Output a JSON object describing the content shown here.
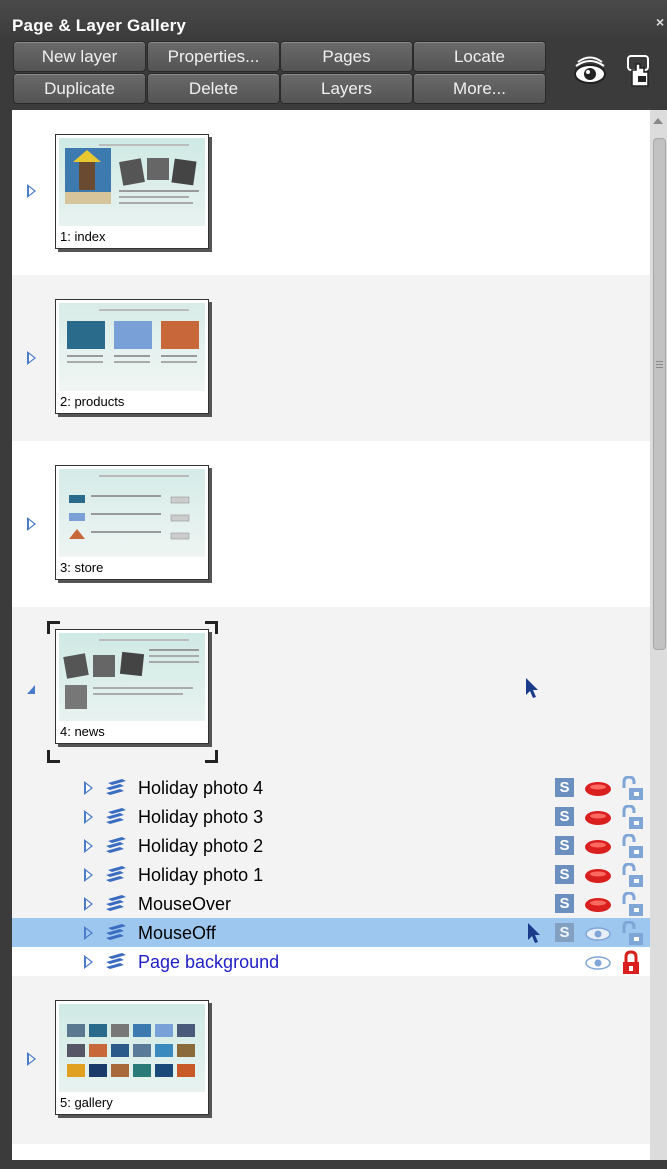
{
  "title": "Page & Layer Gallery",
  "toolbar": {
    "row1": [
      "New layer",
      "Properties...",
      "Pages",
      "Locate"
    ],
    "row2": [
      "Duplicate",
      "Delete",
      "Layers",
      "More..."
    ],
    "icons": [
      "visibility-eye-icon",
      "lock-hand-icon"
    ]
  },
  "pages": [
    {
      "label": "1: index",
      "expanded": false
    },
    {
      "label": "2: products",
      "expanded": false
    },
    {
      "label": "3: store",
      "expanded": false
    },
    {
      "label": "4: news",
      "expanded": true,
      "selected": true
    },
    {
      "label": "5: gallery",
      "expanded": false
    }
  ],
  "layers": [
    {
      "name": "Holiday photo 4",
      "s": true,
      "visible_state": "red",
      "lock": "unlocked"
    },
    {
      "name": "Holiday photo 3",
      "s": true,
      "visible_state": "red",
      "lock": "unlocked"
    },
    {
      "name": "Holiday photo 2",
      "s": true,
      "visible_state": "red",
      "lock": "unlocked"
    },
    {
      "name": "Holiday photo 1",
      "s": true,
      "visible_state": "red",
      "lock": "unlocked"
    },
    {
      "name": "MouseOver",
      "s": true,
      "visible_state": "red",
      "lock": "unlocked"
    },
    {
      "name": "MouseOff",
      "s": true,
      "visible_state": "eye",
      "lock": "unlocked",
      "selected": true
    },
    {
      "name": "Page background",
      "s": false,
      "visible_state": "eye",
      "lock": "locked-red",
      "blue": true
    }
  ],
  "colors": {
    "accent_blue": "#4a7cc9",
    "selection": "#9dc7ee",
    "page_bg_text": "#2020c8",
    "red": "#d9201f"
  }
}
